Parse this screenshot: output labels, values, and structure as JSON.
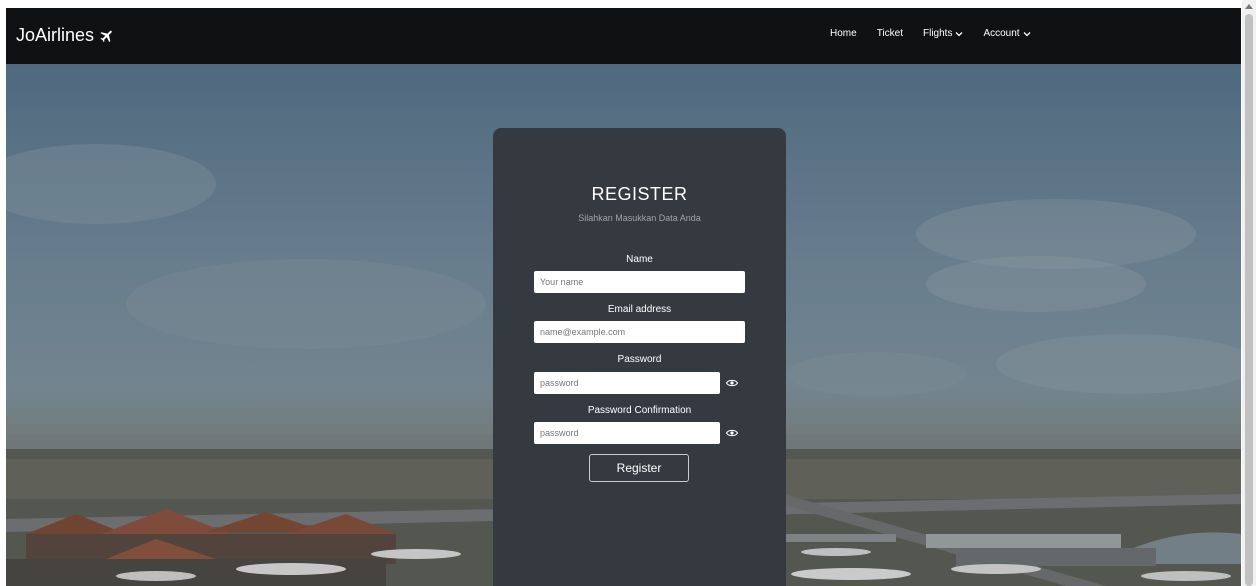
{
  "navbar": {
    "brand": "JoAirlines",
    "links": {
      "home": "Home",
      "ticket": "Ticket",
      "flights": "Flights",
      "account": "Account"
    }
  },
  "form": {
    "title": "REGISTER",
    "subtitle": "Silahkan Masukkan Data Anda",
    "name_label": "Name",
    "name_placeholder": "Your name",
    "email_label": "Email address",
    "email_placeholder": "name@example.com",
    "password_label": "Password",
    "password_placeholder": "password",
    "confirm_label": "Password Confirmation",
    "confirm_placeholder": "password",
    "submit_label": "Register"
  },
  "icons": {
    "brand": "airplane-icon",
    "dropdown": "chevron-down-icon",
    "password_toggle": "eye-icon"
  }
}
